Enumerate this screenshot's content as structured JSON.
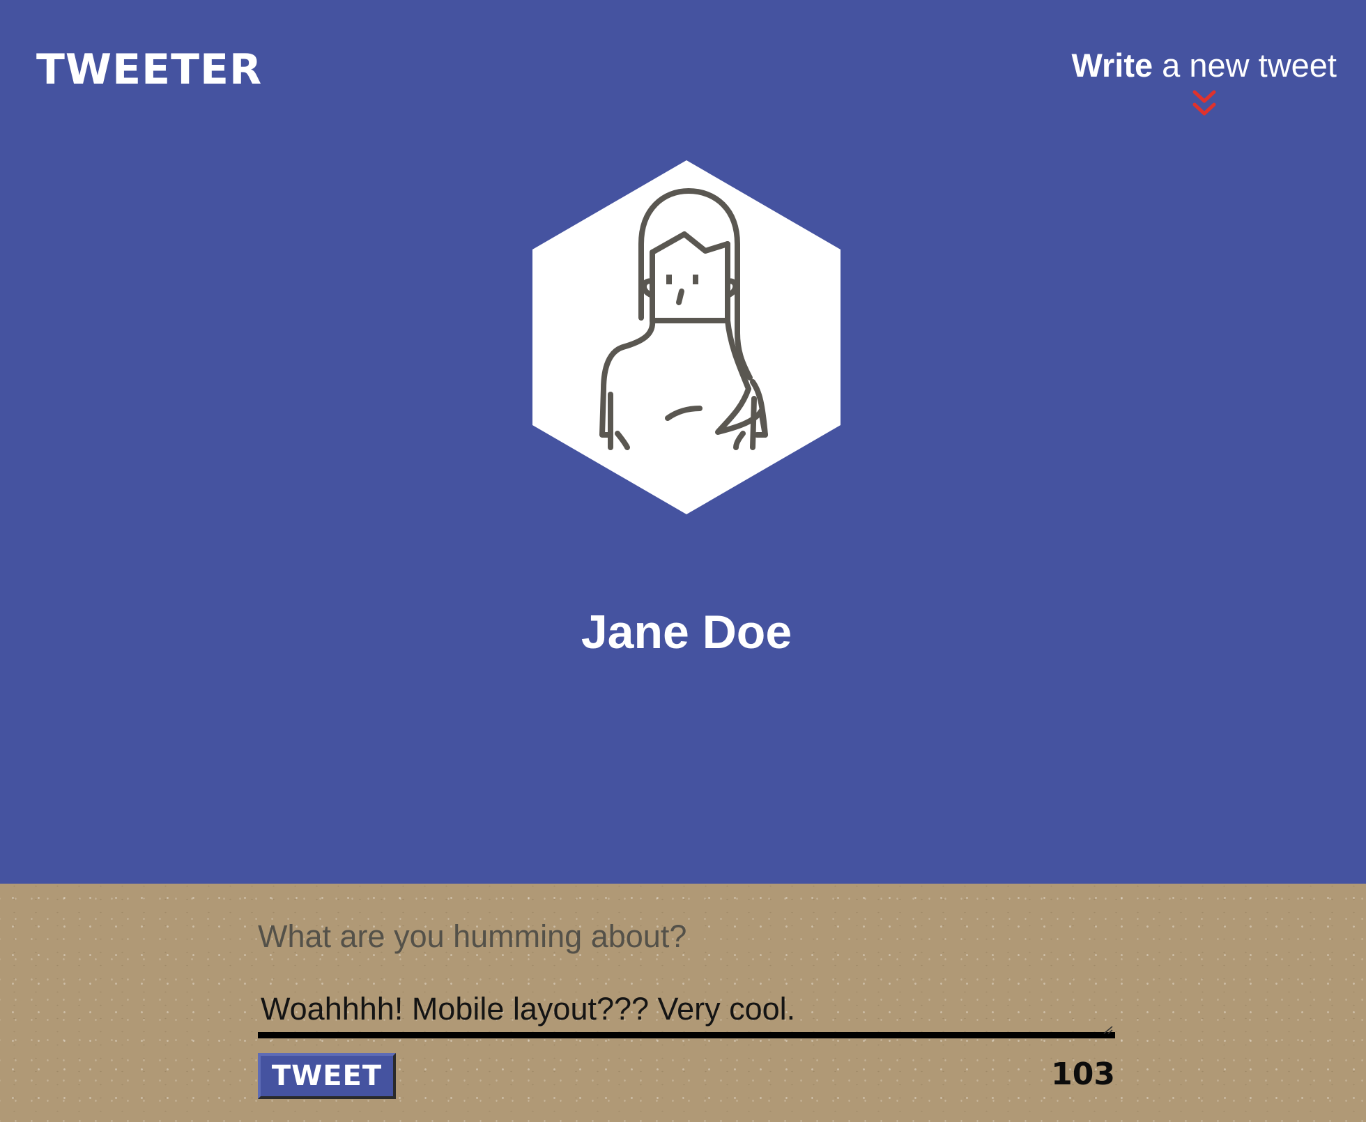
{
  "app": {
    "logo": "TWEETER"
  },
  "nav": {
    "compose_toggle": {
      "bold_word": "Write",
      "rest": " a new tweet",
      "icon": "double-chevron-down-icon",
      "icon_color": "#e0322d"
    }
  },
  "profile": {
    "avatar_icon": "woman-avatar-icon",
    "name": "Jane Doe"
  },
  "composer": {
    "label": "What are you humming about?",
    "text": "Woahhhh! Mobile layout??? Very cool.",
    "button_label": "TWEET",
    "char_count": "103"
  },
  "colors": {
    "header_bg": "#4553a0",
    "composer_bg": "#b09976",
    "accent": "#e0322d"
  }
}
